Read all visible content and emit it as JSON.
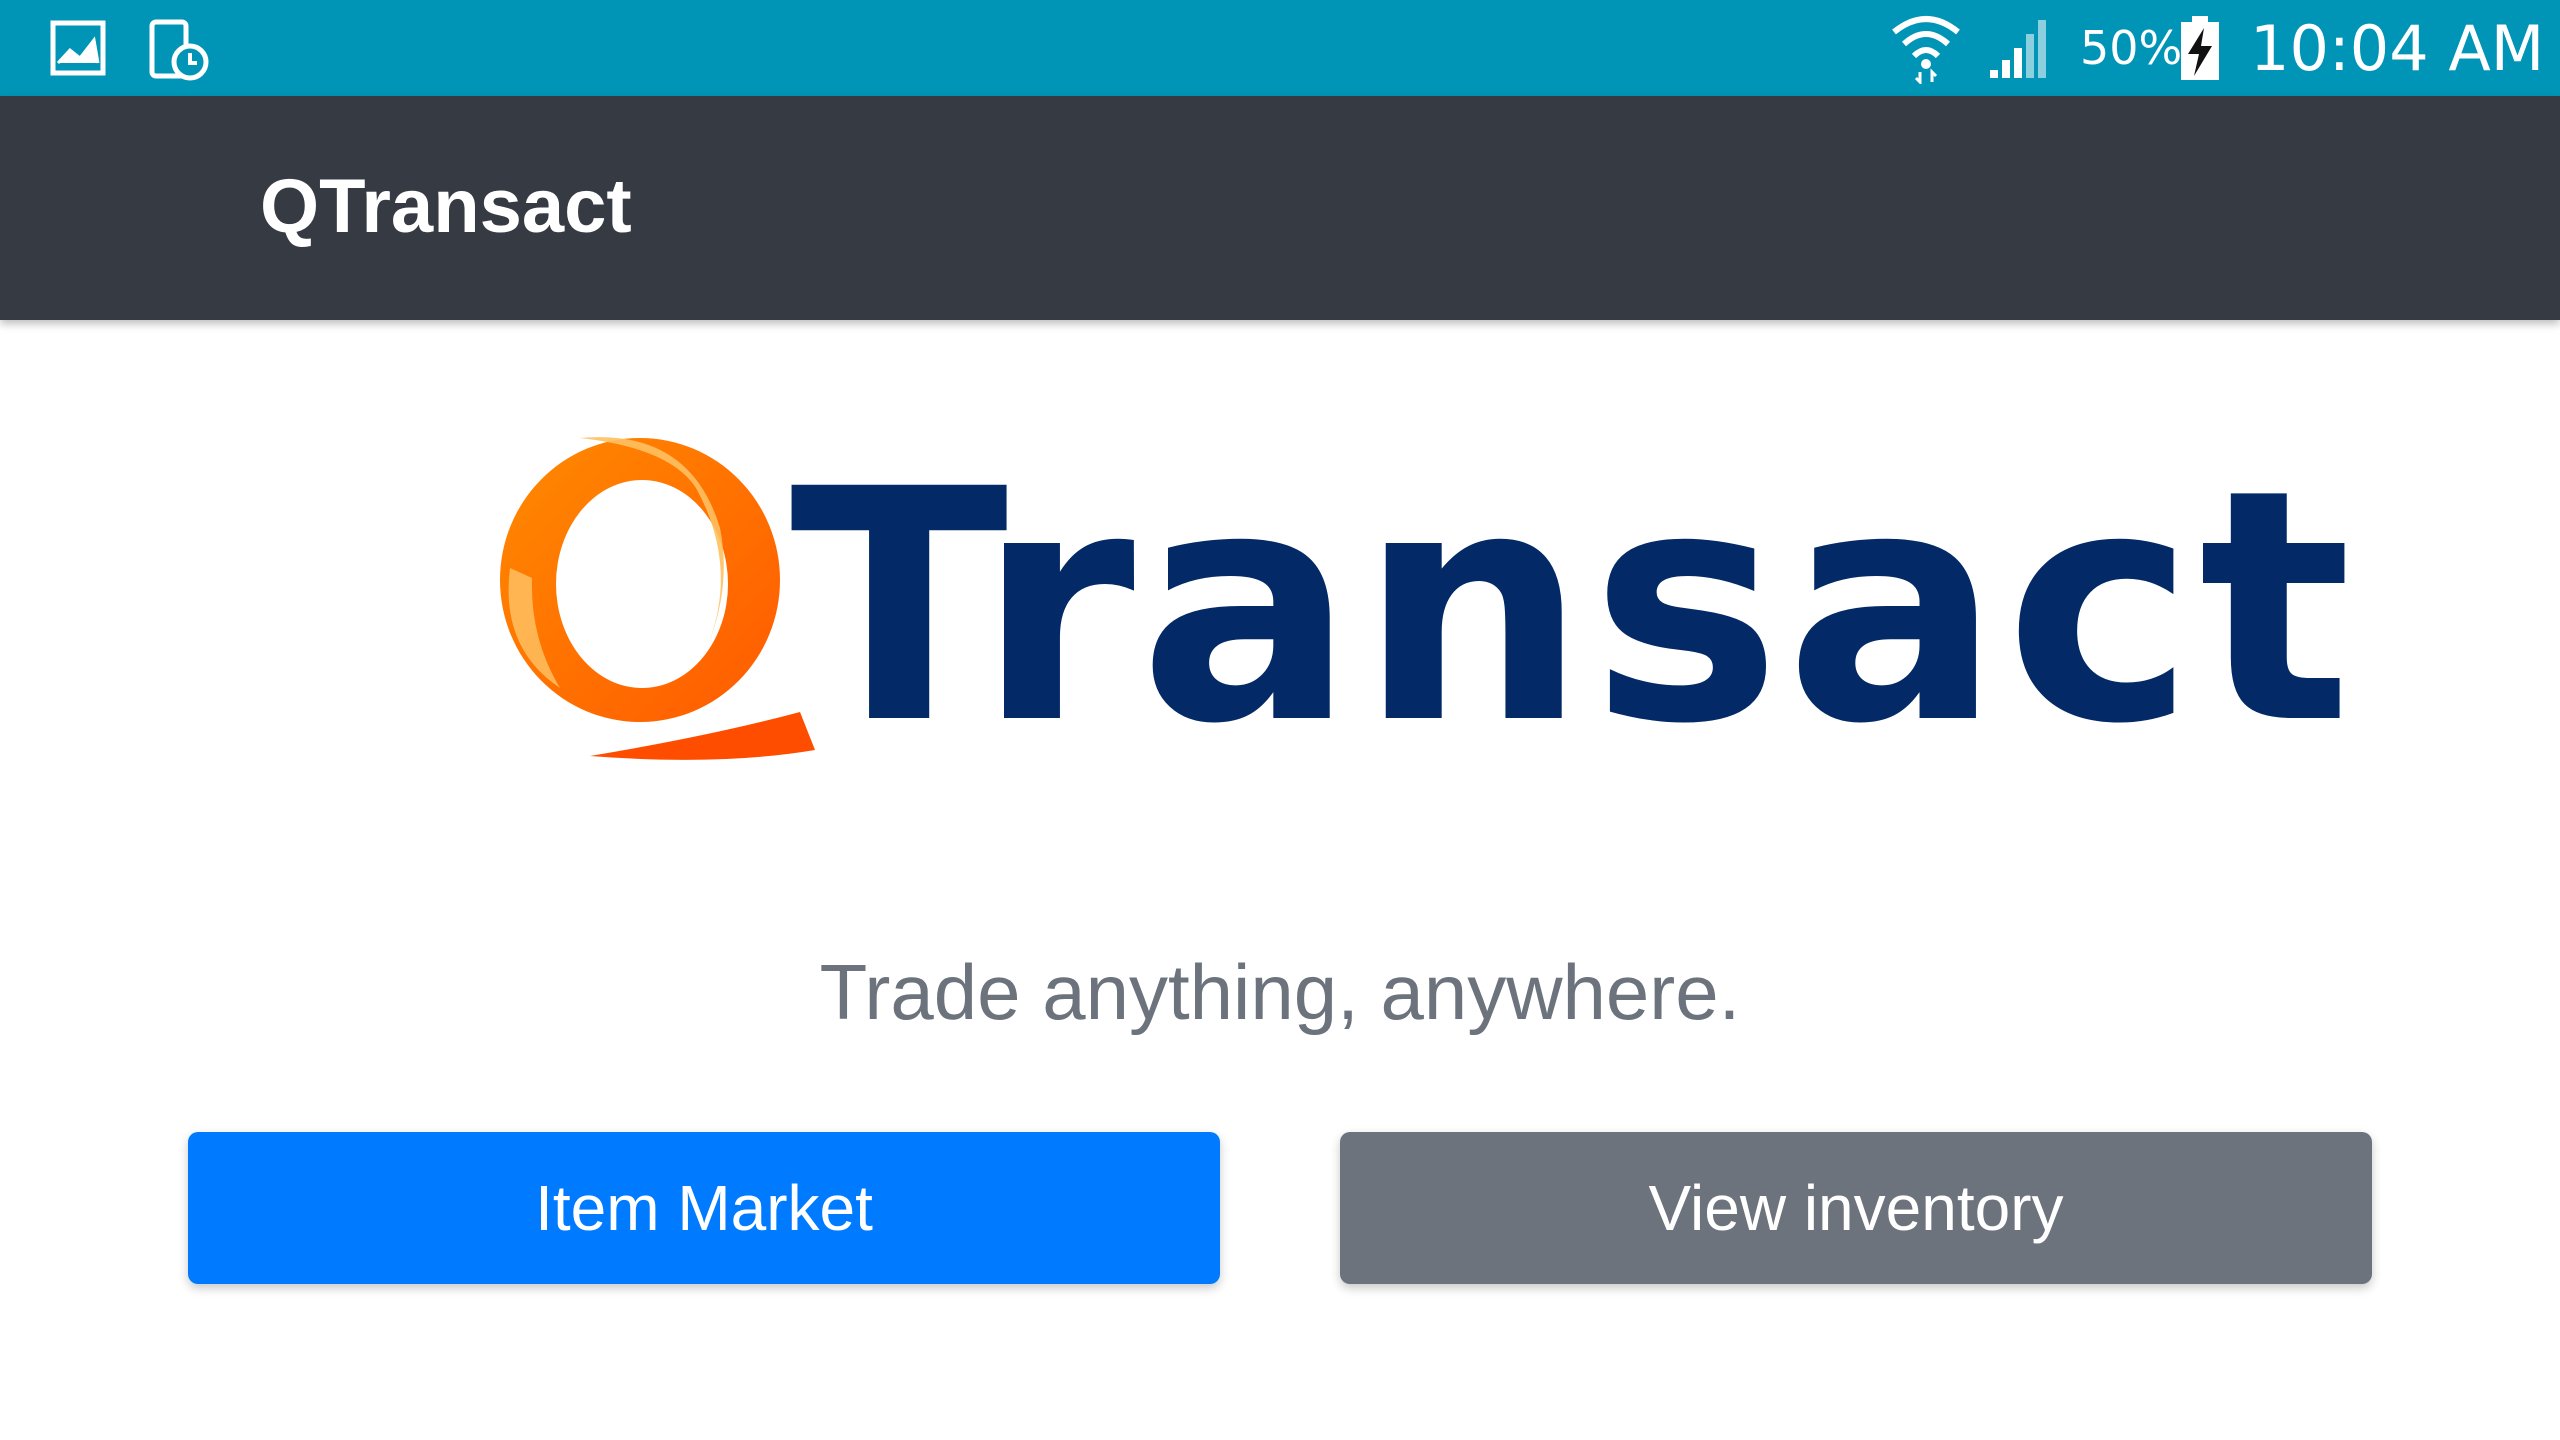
{
  "status_bar": {
    "left_icons": [
      "gallery-icon",
      "screen-timer-icon"
    ],
    "battery_percent": "50%",
    "time": "10:04 AM",
    "color": "#0095b6"
  },
  "app_bar": {
    "title": "QTransact",
    "color": "#363a43"
  },
  "logo": {
    "q_letter": "Q",
    "word": "Transact",
    "q_color": "#ff7a00",
    "word_color": "#032a66"
  },
  "main": {
    "tagline": "Trade anything, anywhere.",
    "buttons": {
      "primary_label": "Item Market",
      "secondary_label": "View inventory"
    }
  },
  "colors": {
    "primary": "#007bff",
    "secondary": "#6c737c",
    "tagline": "#6c737c"
  }
}
